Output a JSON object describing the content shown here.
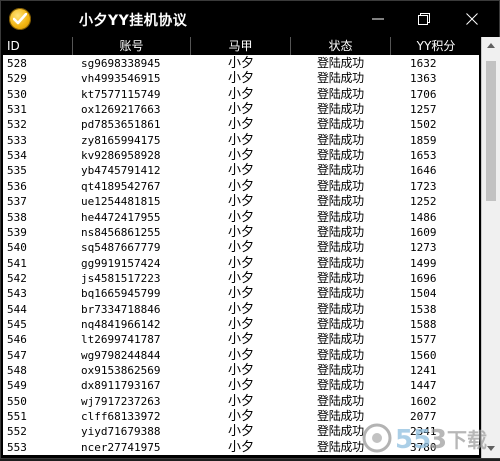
{
  "window": {
    "title": "小夕YY挂机协议"
  },
  "icons": {
    "app": "checkmark-badge-icon",
    "minimize": "minimize-icon",
    "maximize": "restore-icon",
    "close": "close-icon"
  },
  "columns": {
    "id": "ID",
    "account": "账号",
    "vest": "马甲",
    "status": "状态",
    "points": "YY积分"
  },
  "rows": [
    {
      "id": "528",
      "account": "sg9698338945",
      "vest": "小夕",
      "status": "登陆成功",
      "points": "1632"
    },
    {
      "id": "529",
      "account": "vh4993546915",
      "vest": "小夕",
      "status": "登陆成功",
      "points": "1363"
    },
    {
      "id": "530",
      "account": "kt7577115749",
      "vest": "小夕",
      "status": "登陆成功",
      "points": "1706"
    },
    {
      "id": "531",
      "account": "ox1269217663",
      "vest": "小夕",
      "status": "登陆成功",
      "points": "1257"
    },
    {
      "id": "532",
      "account": "pd7853651861",
      "vest": "小夕",
      "status": "登陆成功",
      "points": "1502"
    },
    {
      "id": "533",
      "account": "zy8165994175",
      "vest": "小夕",
      "status": "登陆成功",
      "points": "1859"
    },
    {
      "id": "534",
      "account": "kv9286958928",
      "vest": "小夕",
      "status": "登陆成功",
      "points": "1653"
    },
    {
      "id": "535",
      "account": "yb4745791412",
      "vest": "小夕",
      "status": "登陆成功",
      "points": "1646"
    },
    {
      "id": "536",
      "account": "qt4189542767",
      "vest": "小夕",
      "status": "登陆成功",
      "points": "1723"
    },
    {
      "id": "537",
      "account": "ue1254481815",
      "vest": "小夕",
      "status": "登陆成功",
      "points": "1252"
    },
    {
      "id": "538",
      "account": "he4472417955",
      "vest": "小夕",
      "status": "登陆成功",
      "points": "1486"
    },
    {
      "id": "539",
      "account": "ns8456861255",
      "vest": "小夕",
      "status": "登陆成功",
      "points": "1609"
    },
    {
      "id": "540",
      "account": "sq5487667779",
      "vest": "小夕",
      "status": "登陆成功",
      "points": "1273"
    },
    {
      "id": "541",
      "account": "gg9919157424",
      "vest": "小夕",
      "status": "登陆成功",
      "points": "1499"
    },
    {
      "id": "542",
      "account": "js4581517223",
      "vest": "小夕",
      "status": "登陆成功",
      "points": "1696"
    },
    {
      "id": "543",
      "account": "bq1665945799",
      "vest": "小夕",
      "status": "登陆成功",
      "points": "1504"
    },
    {
      "id": "544",
      "account": "br7334718846",
      "vest": "小夕",
      "status": "登陆成功",
      "points": "1538"
    },
    {
      "id": "545",
      "account": "nq4841966142",
      "vest": "小夕",
      "status": "登陆成功",
      "points": "1588"
    },
    {
      "id": "546",
      "account": "lt2699741787",
      "vest": "小夕",
      "status": "登陆成功",
      "points": "1577"
    },
    {
      "id": "547",
      "account": "wg9798244844",
      "vest": "小夕",
      "status": "登陆成功",
      "points": "1560"
    },
    {
      "id": "548",
      "account": "ox9153862569",
      "vest": "小夕",
      "status": "登陆成功",
      "points": "1241"
    },
    {
      "id": "549",
      "account": "dx8911793167",
      "vest": "小夕",
      "status": "登陆成功",
      "points": "1447"
    },
    {
      "id": "550",
      "account": "wj7917237263",
      "vest": "小夕",
      "status": "登陆成功",
      "points": "1602"
    },
    {
      "id": "551",
      "account": "clff68133972",
      "vest": "小夕",
      "status": "登陆成功",
      "points": "2077"
    },
    {
      "id": "552",
      "account": "yiyd71679388",
      "vest": "小夕",
      "status": "登陆成功",
      "points": "2341"
    },
    {
      "id": "553",
      "account": "ncer27741975",
      "vest": "小夕",
      "status": "登陆成功",
      "points": "3780"
    }
  ],
  "watermark": {
    "text": "下载"
  },
  "colors": {
    "titlebar_bg": "#000000",
    "table_bg": "#ffffff",
    "icon_gold": "#f2b511"
  }
}
